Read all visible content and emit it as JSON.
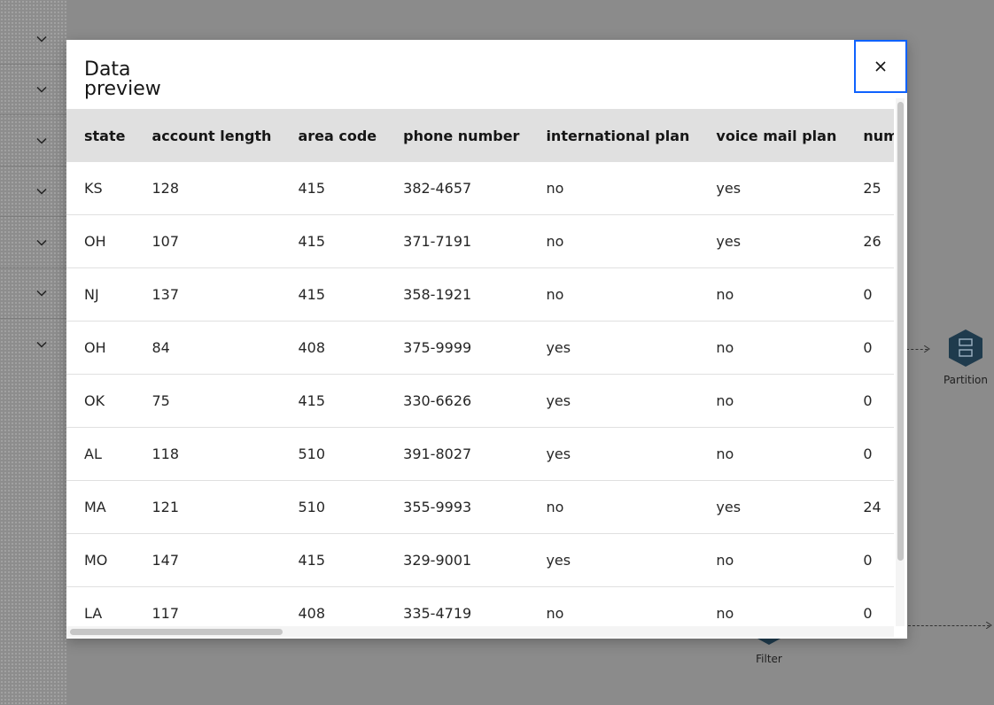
{
  "modal": {
    "title": "Data preview",
    "close_icon": "close-icon"
  },
  "table": {
    "columns": [
      "state",
      "account length",
      "area code",
      "phone number",
      "international plan",
      "voice mail plan",
      "num"
    ],
    "rows": [
      [
        "KS",
        "128",
        "415",
        "382-4657",
        "no",
        "yes",
        "25"
      ],
      [
        "OH",
        "107",
        "415",
        "371-7191",
        "no",
        "yes",
        "26"
      ],
      [
        "NJ",
        "137",
        "415",
        "358-1921",
        "no",
        "no",
        "0"
      ],
      [
        "OH",
        "84",
        "408",
        "375-9999",
        "yes",
        "no",
        "0"
      ],
      [
        "OK",
        "75",
        "415",
        "330-6626",
        "yes",
        "no",
        "0"
      ],
      [
        "AL",
        "118",
        "510",
        "391-8027",
        "yes",
        "no",
        "0"
      ],
      [
        "MA",
        "121",
        "510",
        "355-9993",
        "no",
        "yes",
        "24"
      ],
      [
        "MO",
        "147",
        "415",
        "329-9001",
        "yes",
        "no",
        "0"
      ],
      [
        "LA",
        "117",
        "408",
        "335-4719",
        "no",
        "no",
        "0"
      ]
    ]
  },
  "background": {
    "nodes": [
      {
        "label": "Partition",
        "icon": "partition-node-icon"
      },
      {
        "label": "Filter",
        "icon": "filter-node-icon"
      }
    ],
    "sidebar_icons": "chevron-down-icon"
  },
  "colors": {
    "focus_border": "#0f62fe",
    "header_bg": "#e0e0e0",
    "overlay": "#8b8b8b",
    "node_fill": "#1f3b4d"
  }
}
